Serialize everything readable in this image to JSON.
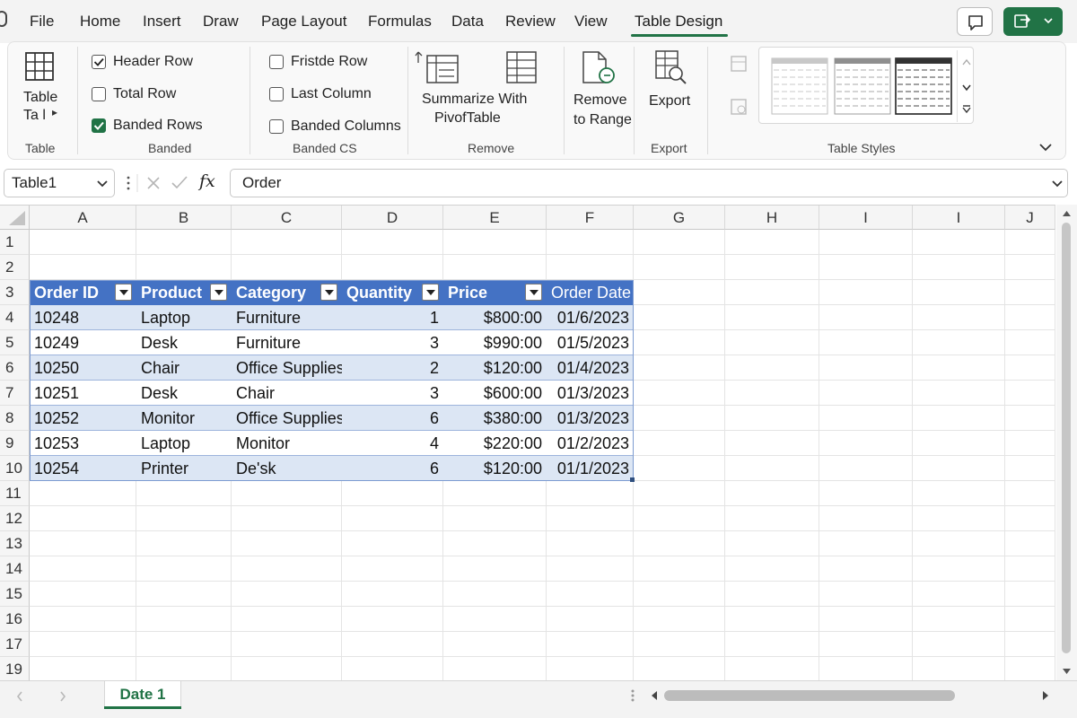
{
  "menu": {
    "tabs": [
      "File",
      "Home",
      "Insert",
      "Draw",
      "Page Layout",
      "Formulas",
      "Data",
      "Review",
      "View",
      "Table Design"
    ],
    "active_tab": "Table Design"
  },
  "ribbon": {
    "table_group": {
      "button_line1": "Table",
      "button_line2": "Ta l",
      "label": "Table"
    },
    "banded_group": {
      "label": "Banded",
      "options": [
        {
          "label": "Header Row",
          "checked": true
        },
        {
          "label": "Total Row",
          "checked": false
        },
        {
          "label": "Banded Rows",
          "checked": true
        }
      ]
    },
    "banded_cs_group": {
      "label": "Banded CS",
      "options": [
        {
          "label": "Fristde Row",
          "checked": false
        },
        {
          "label": "Last Column",
          "checked": false
        },
        {
          "label": "Banded Columns",
          "checked": false
        }
      ]
    },
    "remove_group": {
      "label": "Remove",
      "summarize_line1": "Summarize With",
      "summarize_line2": "PivofTable",
      "remove_line1": "Remove",
      "remove_line2": "to Range"
    },
    "export_group": {
      "button": "Export",
      "label": "Export"
    },
    "styles_group": {
      "label": "Table Styles"
    }
  },
  "formula_bar": {
    "name_box": "Table1",
    "fx": "fx",
    "value": "Order"
  },
  "grid": {
    "columns": [
      "A",
      "B",
      "C",
      "D",
      "E",
      "F",
      "G",
      "H",
      "I",
      "I",
      "J"
    ],
    "rows": [
      "1",
      "2",
      "3",
      "4",
      "5",
      "6",
      "7",
      "8",
      "9",
      "10",
      "11",
      "12",
      "13",
      "14",
      "15",
      "16",
      "17",
      "19"
    ],
    "table_headers": [
      "Order ID",
      "Product",
      "Category",
      "Quantity",
      "Price",
      "Order Date"
    ],
    "table_rows": [
      [
        "10248",
        "Laptop",
        "Furniture",
        "1",
        "$800:00",
        "01/6/2023"
      ],
      [
        "10249",
        "Desk",
        "Furniture",
        "3",
        "$990:00",
        "01/5/2023"
      ],
      [
        "10250",
        "Chair",
        "Office Supplies",
        "2",
        "$120:00",
        "01/4/2023"
      ],
      [
        "10251",
        "Desk",
        "Chair",
        "3",
        "$600:00",
        "01/3/2023"
      ],
      [
        "10252",
        "Monitor",
        "Office Supplies",
        "6",
        "$380:00",
        "01/3/2023"
      ],
      [
        "10253",
        "Laptop",
        "Monitor",
        "4",
        "$220:00",
        "01/2/2023"
      ],
      [
        "10254",
        "Printer",
        "De'sk",
        "6",
        "$120:00",
        "01/1/2023"
      ]
    ],
    "header_color": "#4472c4",
    "band_color": "#dce6f4"
  },
  "sheets": {
    "active": "Date 1"
  },
  "accent_color": "#217346"
}
